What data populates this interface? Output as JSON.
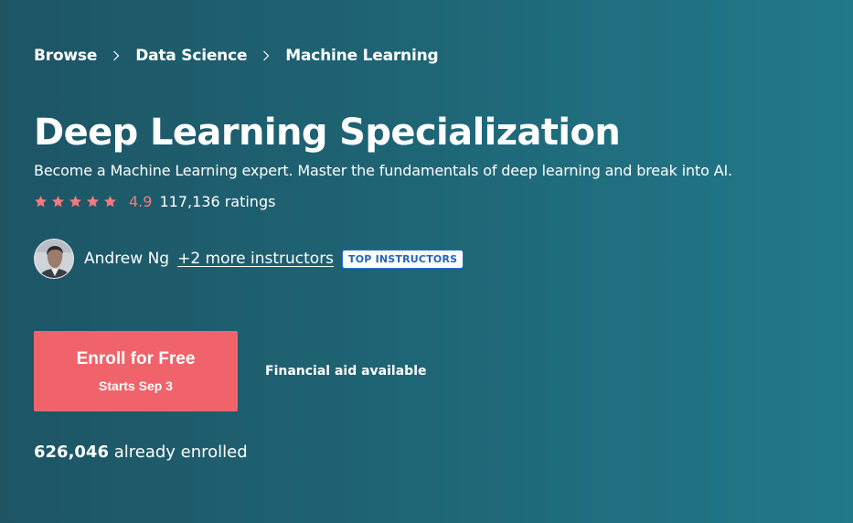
{
  "breadcrumb": {
    "items": [
      "Browse",
      "Data Science",
      "Machine Learning"
    ]
  },
  "course": {
    "title": "Deep Learning Specialization",
    "subtitle": "Become a Machine Learning expert. Master the fundamentals of deep learning and break into AI."
  },
  "rating": {
    "stars": 5,
    "value": "4.9",
    "count_text": "117,136 ratings"
  },
  "instructors": {
    "primary_name": "Andrew Ng",
    "more_link": "+2 more instructors",
    "badge": "TOP INSTRUCTORS"
  },
  "enroll": {
    "label": "Enroll for Free",
    "start": "Starts Sep 3",
    "financial_aid": "Financial aid available"
  },
  "enrollment": {
    "count": "626,046",
    "suffix": " already enrolled"
  },
  "colors": {
    "background_left": "#1d5565",
    "background_right": "#21798a",
    "accent": "#f1636b",
    "star": "#f37a80",
    "badge_text": "#1e64b7"
  },
  "icons": {
    "breadcrumb_separator": "chevron-right-icon",
    "rating_star": "star-icon"
  }
}
